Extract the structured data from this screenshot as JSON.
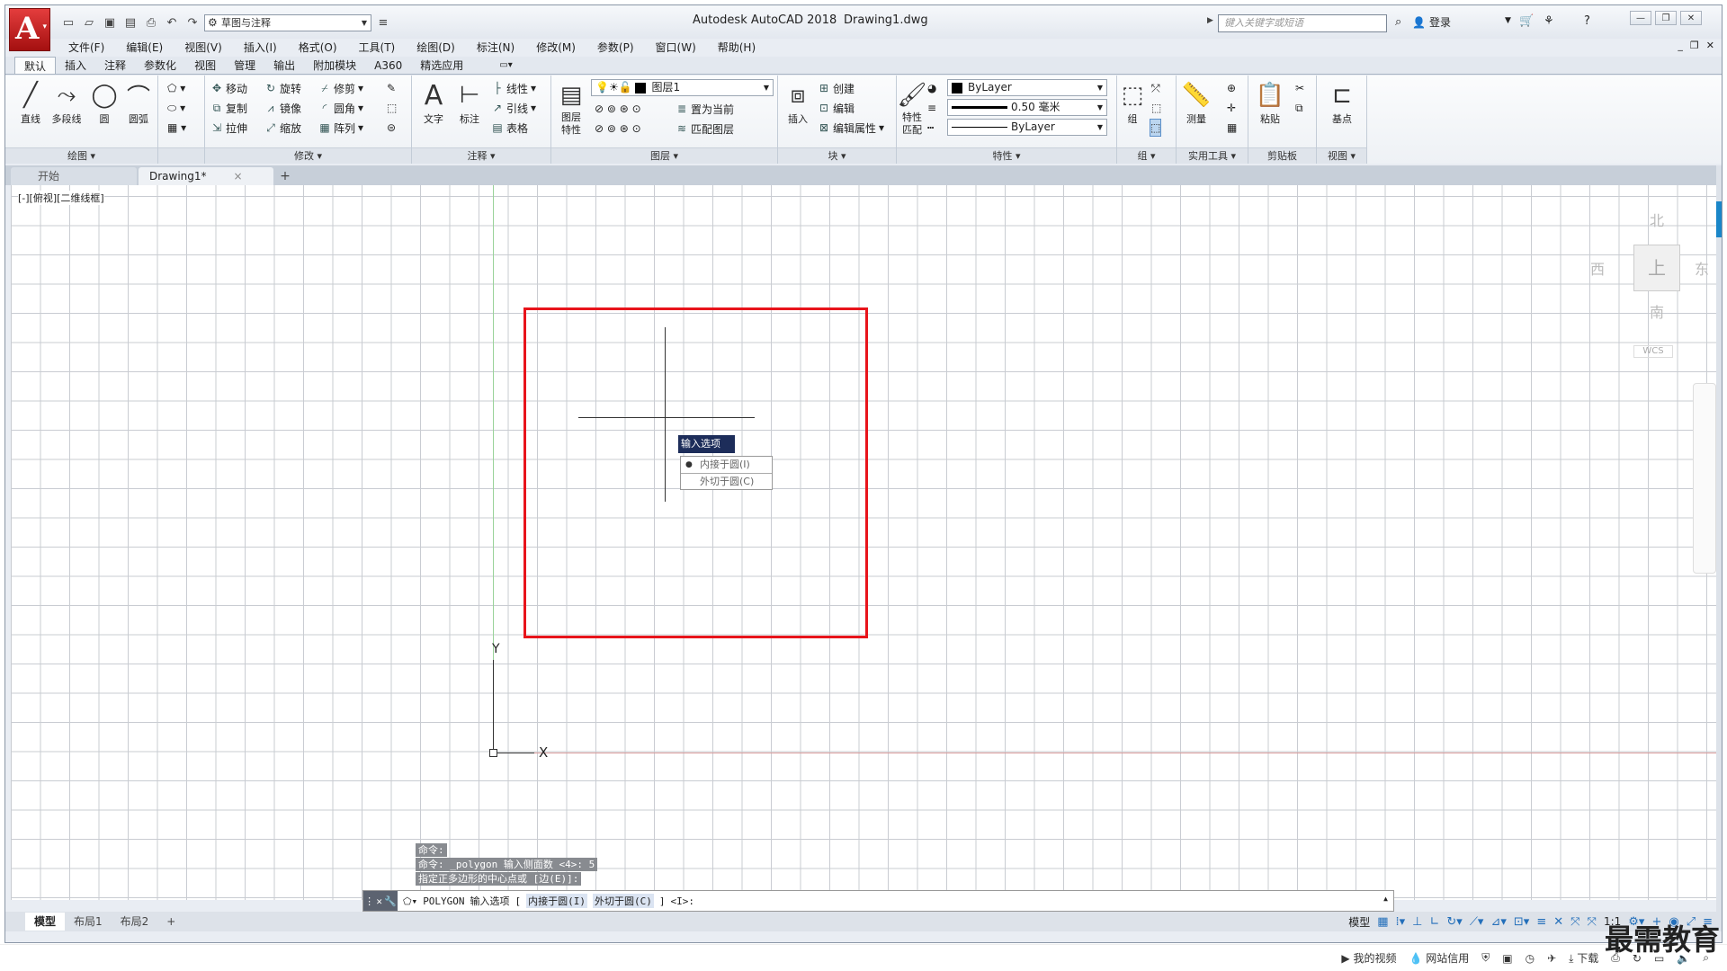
{
  "titlebar": {
    "app": "Autodesk AutoCAD 2018",
    "document": "Drawing1.dwg",
    "workspace": "草图与注释",
    "search_placeholder": "键入关键字或短语",
    "login": "登录"
  },
  "menubar": [
    "文件(F)",
    "编辑(E)",
    "视图(V)",
    "插入(I)",
    "格式(O)",
    "工具(T)",
    "绘图(D)",
    "标注(N)",
    "修改(M)",
    "参数(P)",
    "窗口(W)",
    "帮助(H)"
  ],
  "ribbon_tabs": [
    "默认",
    "插入",
    "注释",
    "参数化",
    "视图",
    "管理",
    "输出",
    "附加模块",
    "A360",
    "精选应用"
  ],
  "ribbon": {
    "draw": {
      "title": "绘图",
      "line": "直线",
      "polyline": "多段线",
      "circle": "圆",
      "arc": "圆弧"
    },
    "modify": {
      "title": "修改",
      "move": "移动",
      "rotate": "旋转",
      "trim": "修剪",
      "copy": "复制",
      "mirror": "镜像",
      "fillet": "圆角",
      "stretch": "拉伸",
      "scale": "缩放",
      "array": "阵列"
    },
    "annotation": {
      "title": "注释",
      "text": "文字",
      "dimension": "标注",
      "linear": "线性",
      "leader": "引线",
      "table": "表格"
    },
    "layers": {
      "title": "图层",
      "layer_properties": "图层特性",
      "current_layer": "图层1",
      "set_current": "置为当前",
      "match_layer": "匹配图层"
    },
    "block": {
      "title": "块",
      "insert": "插入",
      "create": "创建",
      "edit": "编辑",
      "edit_attr": "编辑属性"
    },
    "properties": {
      "title": "特性",
      "match": "特性匹配",
      "color": "ByLayer",
      "lineweight": "0.50 毫米",
      "linetype": "ByLayer"
    },
    "groups": {
      "title": "组",
      "group": "组"
    },
    "utilities": {
      "title": "实用工具",
      "measure": "测量"
    },
    "clipboard": {
      "title": "剪贴板",
      "paste": "粘贴"
    },
    "view": {
      "title": "视图",
      "base": "基点"
    }
  },
  "doctabs": {
    "start": "开始",
    "drawing": "Drawing1*"
  },
  "viewport": {
    "label": "[-][俯视][二维线框]"
  },
  "viewcube": {
    "north": "北",
    "south": "南",
    "west": "西",
    "east": "东",
    "top": "上",
    "wcs": "WCS"
  },
  "ucs": {
    "x": "X",
    "y": "Y"
  },
  "tooltip": {
    "title": "输入选项",
    "options": [
      {
        "label": "内接于圆(I)",
        "selected": true
      },
      {
        "label": "外切于圆(C)",
        "selected": false
      }
    ]
  },
  "command_history": [
    "命令:",
    "命令: _polygon 输入侧面数 <4>: 5",
    "指定正多边形的中心点或 [边(E)]:"
  ],
  "command_line": {
    "cmd": "POLYGON",
    "prompt": "输入选项",
    "open": "[",
    "opt1": "内接于圆(I)",
    "opt2": "外切于圆(C)",
    "close": "]",
    "default": "<I>:"
  },
  "layout_tabs": [
    "模型",
    "布局1",
    "布局2"
  ],
  "statusbar": {
    "model": "模型",
    "scale": "1:1"
  },
  "bottom": {
    "video": "我的视频",
    "net": "网站信用",
    "download": "下载",
    "brand": "最需教育"
  },
  "colors": {
    "highlight": "#e8141b",
    "tooltip_bg": "#1d2d5a",
    "logo": "#c91f1f"
  }
}
